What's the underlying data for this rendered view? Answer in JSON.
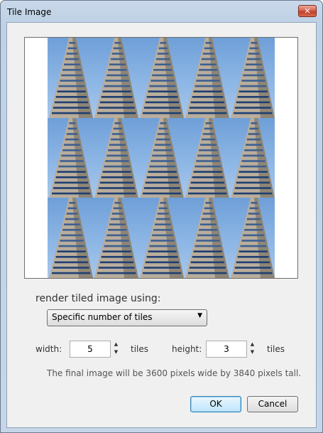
{
  "window": {
    "title": "Tile Image",
    "close_label": "✕"
  },
  "preview": {
    "tiles_wide": 5,
    "tiles_high": 3
  },
  "render": {
    "label": "render tiled image using:",
    "mode_selected": "Specific number of tiles"
  },
  "width": {
    "label": "width:",
    "value": "5",
    "unit": "tiles"
  },
  "height": {
    "label": "height:",
    "value": "3",
    "unit": "tiles"
  },
  "info_text": "The final image will be 3600 pixels wide by 3840 pixels tall.",
  "buttons": {
    "ok": "OK",
    "cancel": "Cancel"
  },
  "icons": {
    "spin_up": "▲",
    "spin_down": "▼",
    "dropdown": "▼"
  }
}
